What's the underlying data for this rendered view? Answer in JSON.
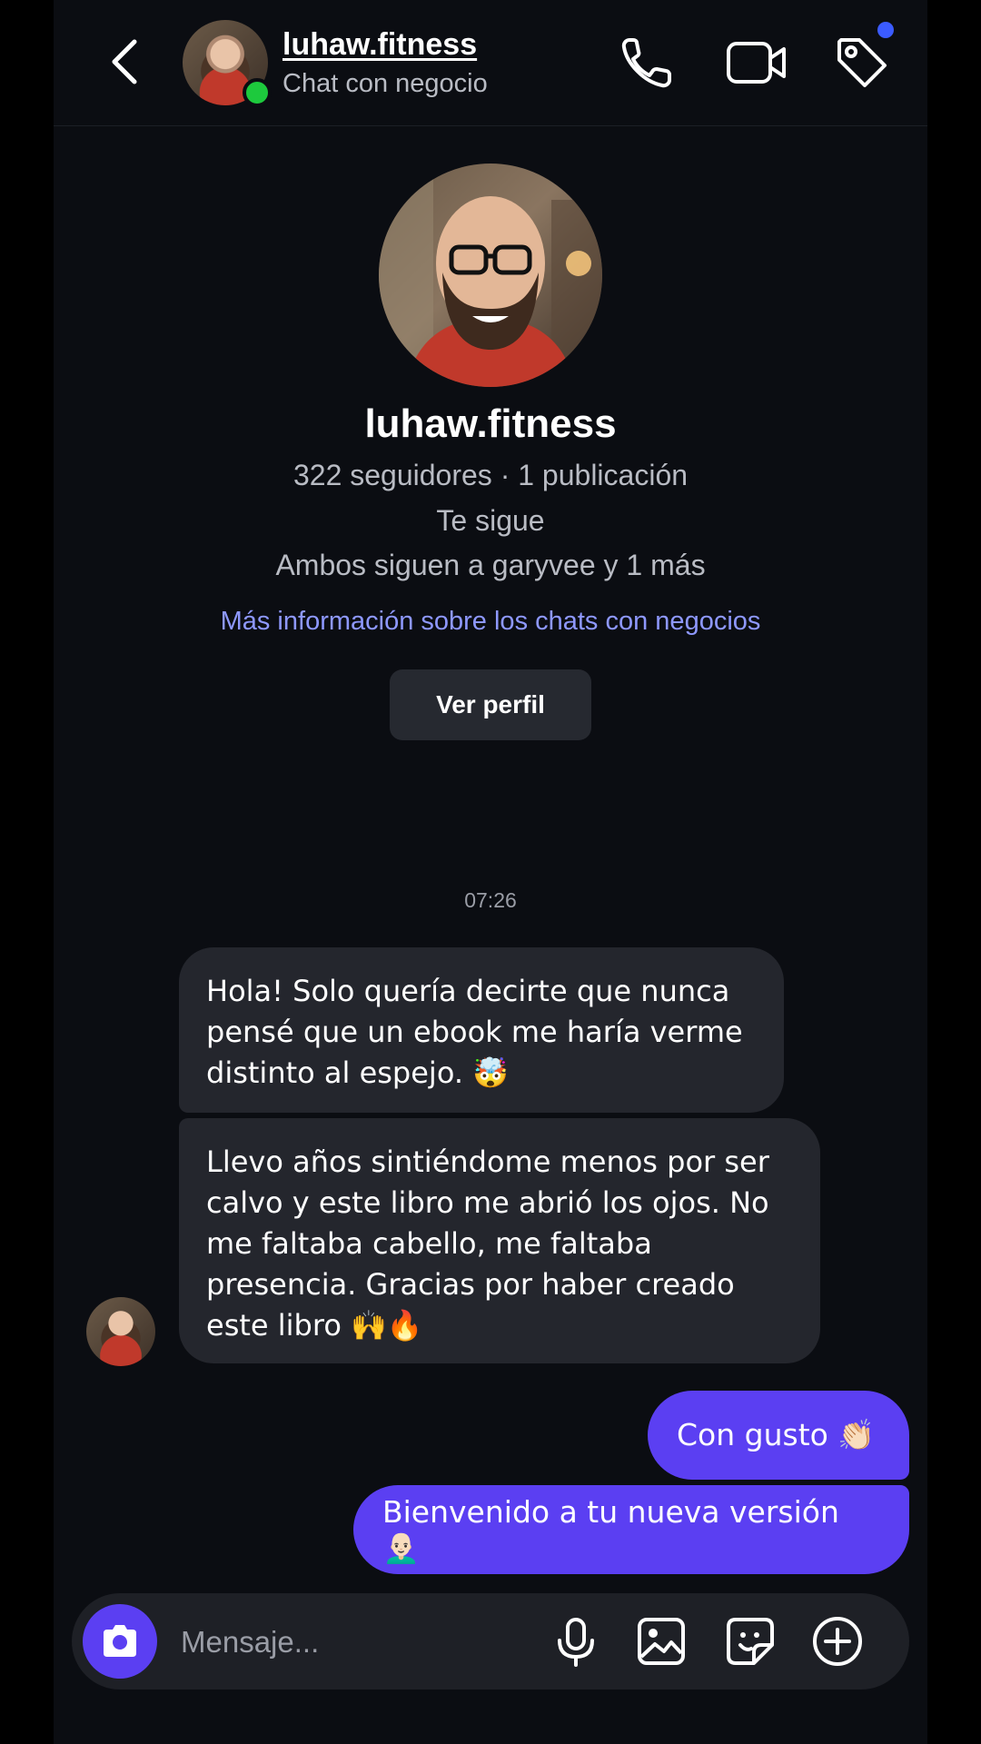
{
  "header": {
    "name": "luhaw.fitness",
    "subtitle": "Chat con negocio",
    "icons": [
      "back-arrow-icon",
      "phone-icon",
      "video-call-icon",
      "tag-icon"
    ]
  },
  "profile": {
    "name": "luhaw.fitness",
    "stats": "322 seguidores · 1 publicación",
    "follow_status": "Te sigue",
    "mutual": "Ambos siguen a garyvee y 1 más",
    "info_link": "Más información sobre los chats con negocios",
    "view_profile_label": "Ver perfil"
  },
  "chat": {
    "timestamp": "07:26",
    "incoming": [
      "Hola! Solo quería decirte que nunca pensé que un ebook me haría verme distinto al espejo. 🤯",
      "Llevo años sintiéndome menos por ser calvo y este libro me abrió los ojos. No me faltaba cabello, me faltaba presencia. Gracias por haber creado este libro  🙌🔥"
    ],
    "outgoing": [
      "Con gusto 👏🏻",
      "Bienvenido a tu nueva versión 👨🏻‍🦲"
    ]
  },
  "composer": {
    "placeholder": "Mensaje...",
    "icons": [
      "camera-icon",
      "microphone-icon",
      "gallery-icon",
      "sticker-icon",
      "plus-icon"
    ]
  },
  "colors": {
    "background": "#0b0d12",
    "bubble_in": "#24262d",
    "bubble_out": "#5b3ff2",
    "link": "#8e98ff",
    "online": "#1dc93d"
  }
}
